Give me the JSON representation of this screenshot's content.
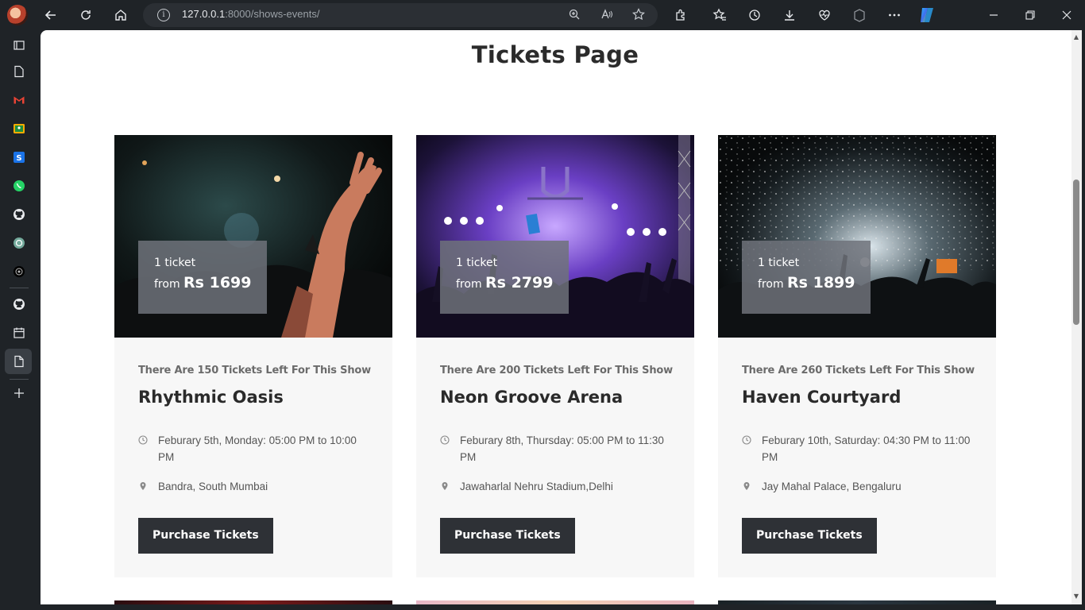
{
  "browser": {
    "url_host": "127.0.0.1",
    "url_rest": ":8000/shows-events/"
  },
  "page": {
    "title": "Tickets Page"
  },
  "cards": [
    {
      "ticket_count_label": "1 ticket",
      "from_label": "from",
      "price": "Rs 1699",
      "tickets_left": "There Are 150 Tickets Left For This Show",
      "name": "Rhythmic Oasis",
      "datetime": "Feburary 5th, Monday: 05:00 PM to 10:00 PM",
      "location": "Bandra, South Mumbai",
      "button": "Purchase Tickets"
    },
    {
      "ticket_count_label": "1 ticket",
      "from_label": "from",
      "price": "Rs 2799",
      "tickets_left": "There Are 200 Tickets Left For This Show",
      "name": "Neon Groove Arena",
      "datetime": "Feburary 8th, Thursday: 05:00 PM to 11:30 PM",
      "location": "Jawaharlal Nehru Stadium,Delhi",
      "button": "Purchase Tickets"
    },
    {
      "ticket_count_label": "1 ticket",
      "from_label": "from",
      "price": "Rs 1899",
      "tickets_left": "There Are 260 Tickets Left For This Show",
      "name": "Haven Courtyard",
      "datetime": "Feburary 10th, Saturday: 04:30 PM to 11:00 PM",
      "location": "Jay Mahal Palace, Bengaluru",
      "button": "Purchase Tickets"
    }
  ],
  "colors": {
    "button_bg": "#2e3136",
    "card_bg": "#f7f7f7",
    "price_overlay": "#6e727a"
  }
}
